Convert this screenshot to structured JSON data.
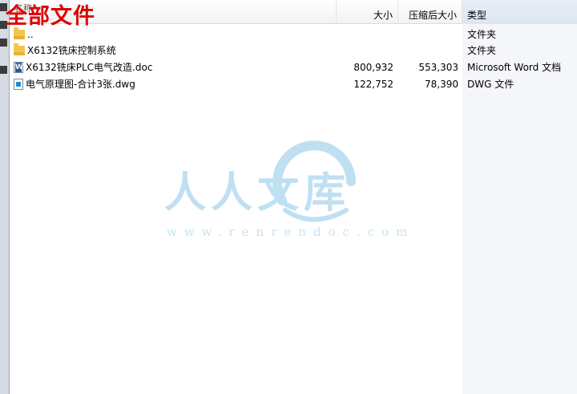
{
  "title_overlay": "全部文件",
  "columns": {
    "name": "名称",
    "size": "大小",
    "compressed": "压缩后大小",
    "type": "类型"
  },
  "rows": [
    {
      "icon": "folder-up-icon",
      "name": "..",
      "size": "",
      "compressed": "",
      "type": "文件夹"
    },
    {
      "icon": "folder-icon",
      "name": "X6132铣床控制系统",
      "size": "",
      "compressed": "",
      "type": "文件夹"
    },
    {
      "icon": "word-doc-icon",
      "name": "X6132铣床PLC电气改造.doc",
      "size": "800,932",
      "compressed": "553,303",
      "type": "Microsoft Word 文档"
    },
    {
      "icon": "dwg-file-icon",
      "name": "电气原理图-合计3张.dwg",
      "size": "122,752",
      "compressed": "78,390",
      "type": "DWG 文件"
    }
  ],
  "watermark": {
    "text": "人人文库",
    "url": "www.renrendoc.com",
    "color": "#bfe0f2"
  },
  "colors": {
    "title": "#e00000",
    "folder": "#f3c54a"
  }
}
